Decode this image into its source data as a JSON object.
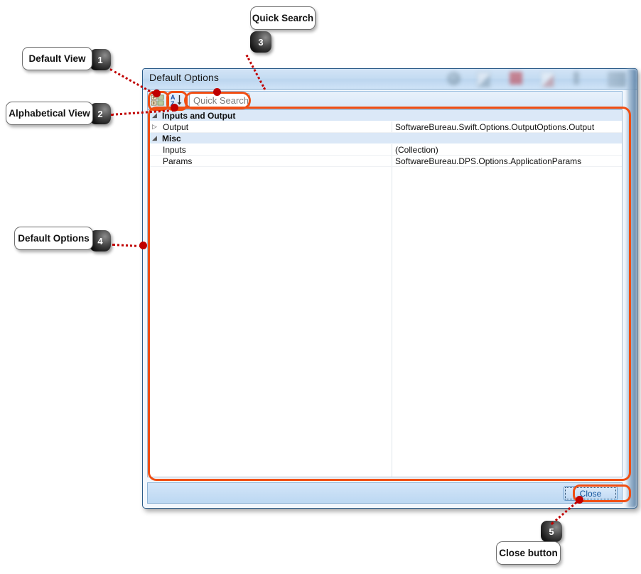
{
  "dialog": {
    "title": "Default Options",
    "titlebar_ghost_icons": [
      "gear-icon",
      "document-icon",
      "red-square-icon",
      "document-icon",
      "faint-mark-icon",
      "panel-icon"
    ],
    "toolbar": {
      "categorized_button": "Categorized",
      "categorized_icon": "categorized-grid-icon",
      "alphabetical_button": "Alphabetical",
      "alphabetical_icon": "sort-az-icon",
      "search_placeholder": "Quick Search"
    },
    "grid": {
      "rows": [
        {
          "kind": "category",
          "expander": "◢",
          "name": "Inputs and Output",
          "value": ""
        },
        {
          "kind": "property",
          "expander": "▷",
          "name": "Output",
          "value": "SoftwareBureau.Swift.Options.OutputOptions.Output"
        },
        {
          "kind": "category",
          "expander": "◢",
          "name": "Misc",
          "value": ""
        },
        {
          "kind": "property",
          "expander": "",
          "name": "Inputs",
          "value": "(Collection)"
        },
        {
          "kind": "property",
          "expander": "",
          "name": "Params",
          "value": "SoftwareBureau.DPS.Options.ApplicationParams"
        }
      ]
    },
    "footer": {
      "close_label": "Close"
    }
  },
  "callouts": [
    {
      "number": "1",
      "label": "Default View"
    },
    {
      "number": "2",
      "label": "Alphabetical View"
    },
    {
      "number": "3",
      "label": "Quick Search"
    },
    {
      "number": "4",
      "label": "Default Options"
    },
    {
      "number": "5",
      "label": "Close button"
    }
  ],
  "colors": {
    "highlight": "#f04e13",
    "leader": "#c00000",
    "title_bar": "#c5dcf2",
    "category_row": "#dbe8f7",
    "close_text": "#12549b"
  }
}
